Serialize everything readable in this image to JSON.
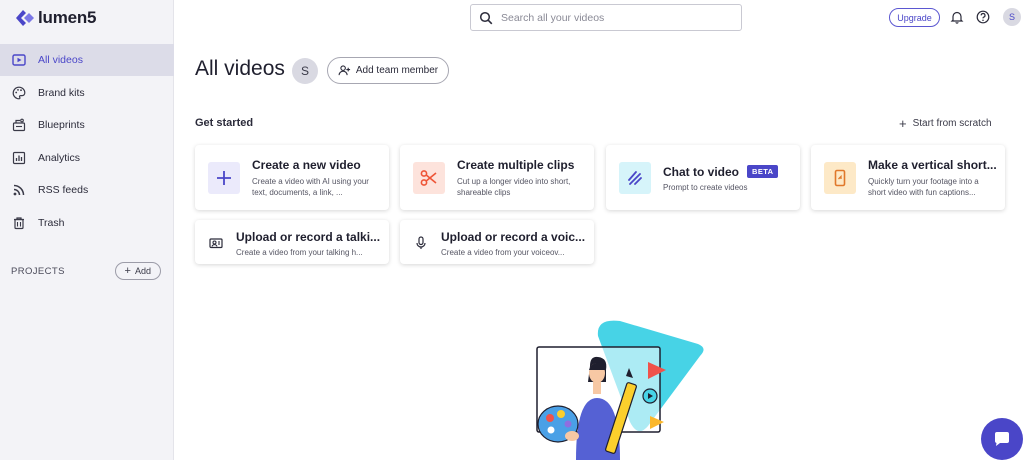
{
  "app": {
    "logo_text": "lumen5"
  },
  "sidebar": {
    "items": [
      {
        "label": "All videos",
        "icon": "play-square-icon",
        "active": true
      },
      {
        "label": "Brand kits",
        "icon": "palette-icon",
        "active": false
      },
      {
        "label": "Blueprints",
        "icon": "blueprint-icon",
        "active": false
      },
      {
        "label": "Analytics",
        "icon": "bar-chart-icon",
        "active": false
      },
      {
        "label": "RSS feeds",
        "icon": "rss-icon",
        "active": false
      },
      {
        "label": "Trash",
        "icon": "trash-icon",
        "active": false
      }
    ],
    "projects_label": "PROJECTS",
    "add_label": "Add"
  },
  "topbar": {
    "search_placeholder": "Search all your videos",
    "upgrade_label": "Upgrade",
    "avatar_initial": "S"
  },
  "header": {
    "title": "All videos",
    "avatar_initial": "S",
    "add_team_label": "Add team member"
  },
  "get_started": {
    "label": "Get started",
    "scratch_label": "Start from scratch"
  },
  "cards": [
    {
      "title": "Create a new video",
      "desc": "Create a video with AI using your text, documents, a link, ...",
      "icon": "plus-icon"
    },
    {
      "title": "Create multiple clips",
      "desc": "Cut up a longer video into short, shareable clips",
      "icon": "scissors-icon"
    },
    {
      "title": "Chat to video",
      "badge": "BETA",
      "desc": "Prompt to create videos",
      "icon": "chat-wand-icon"
    },
    {
      "title": "Make a vertical short...",
      "desc": "Quickly turn your footage into a short video with fun captions...",
      "icon": "vertical-video-icon"
    },
    {
      "title": "Upload or record a talki...",
      "desc": "Create a video from your talking h...",
      "icon": "camera-icon"
    },
    {
      "title": "Upload or record a voic...",
      "desc": "Create a video from your voiceov...",
      "icon": "microphone-icon"
    }
  ],
  "colors": {
    "accent": "#4a46c8",
    "sidebar_bg": "#f3f3f7",
    "illustration_cyan": "#47d3e6"
  }
}
